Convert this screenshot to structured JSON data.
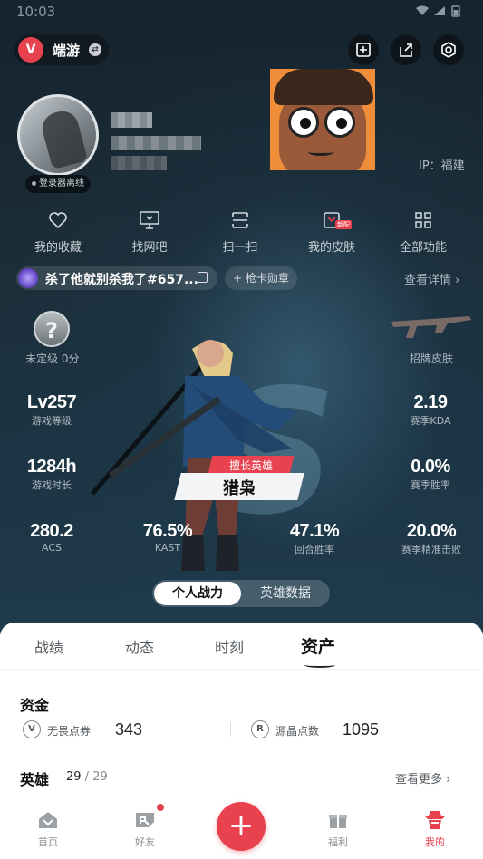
{
  "status_bar": {
    "time": "10:03",
    "system_icons": "wifi-icon signal-icon battery-icon"
  },
  "app": {
    "name": "端游",
    "logo_text": "V"
  },
  "header_icons": [
    "edit-card-icon",
    "share-icon",
    "settings-icon"
  ],
  "profile": {
    "login_status": "登录器离线",
    "ip": "IP：福建"
  },
  "quick_actions": [
    {
      "label": "我的收藏",
      "icon": "heart-icon"
    },
    {
      "label": "找网吧",
      "icon": "monitor-icon"
    },
    {
      "label": "扫一扫",
      "icon": "scan-icon"
    },
    {
      "label": "我的皮肤",
      "icon": "skin-icon",
      "tag": "新配"
    },
    {
      "label": "全部功能",
      "icon": "grid-icon"
    }
  ],
  "title_badge": {
    "text": "杀了他就别杀我了#657..."
  },
  "medal_button": "+ 枪卡勋章",
  "view_detail": "查看详情 ›",
  "rank": {
    "icon_text": "?",
    "label": "未定级 0分"
  },
  "signature_skin": {
    "label": "招牌皮肤"
  },
  "stats": {
    "level": {
      "value": "Lv257",
      "label": "游戏等级"
    },
    "kda": {
      "value": "2.19",
      "label": "赛季KDA"
    },
    "hours": {
      "value": "1284h",
      "label": "游戏时长"
    },
    "win_rate": {
      "value": "0.0%",
      "label": "赛季胜率"
    },
    "acs": {
      "value": "280.2",
      "label": "ACS"
    },
    "kast": {
      "value": "76.5%",
      "label": "KAST"
    },
    "round_win": {
      "value": "47.1%",
      "label": "回合胜率"
    },
    "precision": {
      "value": "20.0%",
      "label": "赛季精准击败"
    }
  },
  "best_hero": {
    "tag": "擅长英雄",
    "name": "猎枭"
  },
  "segment": {
    "active": "个人战力",
    "inactive": "英雄数据"
  },
  "tabs": [
    "战绩",
    "动态",
    "时刻",
    "资产"
  ],
  "assets": {
    "funds_title": "资金",
    "currency1": {
      "icon_text": "V",
      "label": "无畏点券",
      "value": "343"
    },
    "currency2": {
      "icon_text": "R",
      "label": "源晶点数",
      "value": "1095"
    },
    "heroes_title": "英雄",
    "heroes_owned": "29",
    "heroes_total": " / 29",
    "see_more": "查看更多 ›"
  },
  "nav": [
    {
      "label": "首页",
      "icon": "home-icon"
    },
    {
      "label": "好友",
      "icon": "friends-icon"
    },
    {
      "label": "+",
      "icon": "plus-icon"
    },
    {
      "label": "福利",
      "icon": "gift-icon"
    },
    {
      "label": "我的",
      "icon": "profile-icon"
    }
  ],
  "colors": {
    "accent": "#e8424e",
    "dark_bg": "#1b2d38"
  }
}
